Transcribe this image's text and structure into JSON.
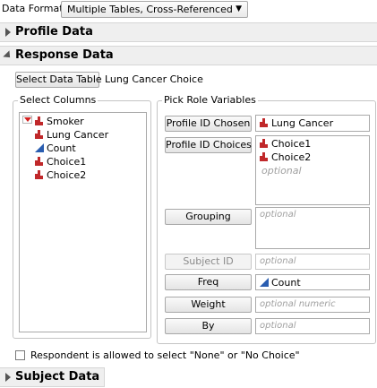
{
  "data_format": {
    "label": "Data Format",
    "value": "Multiple Tables, Cross-Referenced"
  },
  "sections": {
    "profile": "Profile Data",
    "response": "Response Data",
    "subject": "Subject Data"
  },
  "select_table": {
    "button": "Select Data Table",
    "table_name": "Lung Cancer Choice"
  },
  "select_columns": {
    "label": "Select Columns",
    "columns": [
      {
        "name": "Smoker",
        "icon": "nominal-icon"
      },
      {
        "name": "Lung Cancer",
        "icon": "nominal-icon"
      },
      {
        "name": "Count",
        "icon": "continuous-icon"
      },
      {
        "name": "Choice1",
        "icon": "nominal-icon"
      },
      {
        "name": "Choice2",
        "icon": "nominal-icon"
      }
    ]
  },
  "pick_roles": {
    "label": "Pick Role Variables",
    "profile_id_chosen": {
      "button": "Profile ID Chosen",
      "value": "Lung Cancer"
    },
    "profile_id_choices": {
      "button": "Profile ID Choices",
      "values": [
        "Choice1",
        "Choice2"
      ],
      "placeholder": "optional"
    },
    "grouping": {
      "button": "Grouping",
      "placeholder": "optional"
    },
    "subject_id": {
      "button": "Subject ID",
      "placeholder": "optional"
    },
    "freq": {
      "button": "Freq",
      "value": "Count"
    },
    "weight": {
      "button": "Weight",
      "placeholder": "optional numeric"
    },
    "by": {
      "button": "By",
      "placeholder": "optional"
    }
  },
  "none_option": {
    "label": "Respondent is allowed to select \"None\" or \"No Choice\"",
    "checked": false
  },
  "colors": {
    "nominal": "#c0282a",
    "continuous": "#2a5db0",
    "header_bg": "#efefef"
  }
}
